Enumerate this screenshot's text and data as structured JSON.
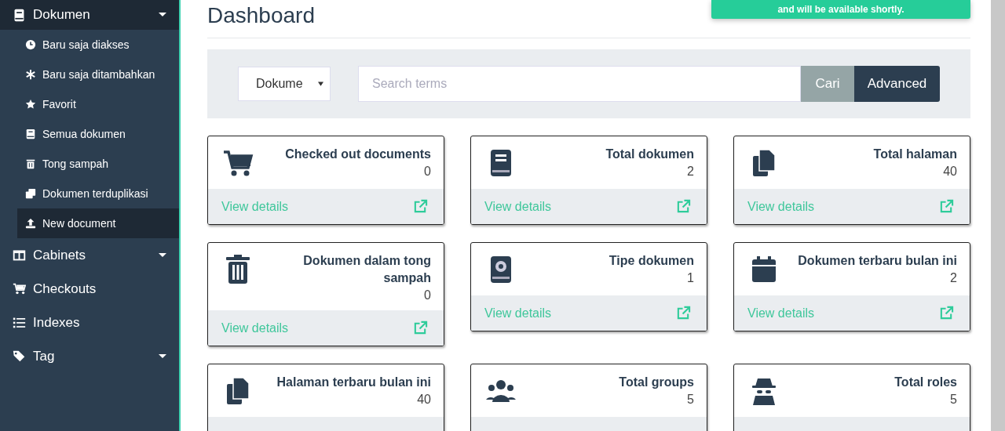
{
  "sidebar": {
    "sections": [
      {
        "label": "Dokumen",
        "dropdown": true,
        "expanded": true,
        "children": [
          {
            "label": "Baru saja diakses",
            "selected": false
          },
          {
            "label": "Baru saja ditambahkan",
            "selected": false
          },
          {
            "label": "Favorit",
            "selected": false
          },
          {
            "label": "Semua dokumen",
            "selected": false
          },
          {
            "label": "Tong sampah",
            "selected": false
          },
          {
            "label": "Dokumen terduplikasi",
            "selected": false
          },
          {
            "label": "New document",
            "selected": true
          }
        ]
      },
      {
        "label": "Cabinets",
        "dropdown": true,
        "expanded": false
      },
      {
        "label": "Checkouts",
        "dropdown": false,
        "expanded": false
      },
      {
        "label": "Indexes",
        "dropdown": false,
        "expanded": false
      },
      {
        "label": "Tag",
        "dropdown": true,
        "expanded": false
      }
    ]
  },
  "toast": {
    "message": "and will be available shortly."
  },
  "page": {
    "title": "Dashboard"
  },
  "search": {
    "scope": "Dokume",
    "placeholder": "Search terms",
    "buttons": [
      "Cari",
      "Advanced"
    ]
  },
  "cards": [
    {
      "title": "Checked out documents",
      "value": "0",
      "link": "View details"
    },
    {
      "title": "Total dokumen",
      "value": "2",
      "link": "View details"
    },
    {
      "title": "Total halaman",
      "value": "40",
      "link": "View details"
    },
    {
      "title": "Dokumen dalam tong sampah",
      "value": "0",
      "link": "View details"
    },
    {
      "title": "Tipe dokumen",
      "value": "1",
      "link": "View details"
    },
    {
      "title": "Dokumen terbaru bulan ini",
      "value": "2",
      "link": "View details"
    },
    {
      "title": "Halaman terbaru bulan ini",
      "value": "40"
    },
    {
      "title": "Total groups",
      "value": "5"
    },
    {
      "title": "Total roles",
      "value": "5"
    }
  ]
}
